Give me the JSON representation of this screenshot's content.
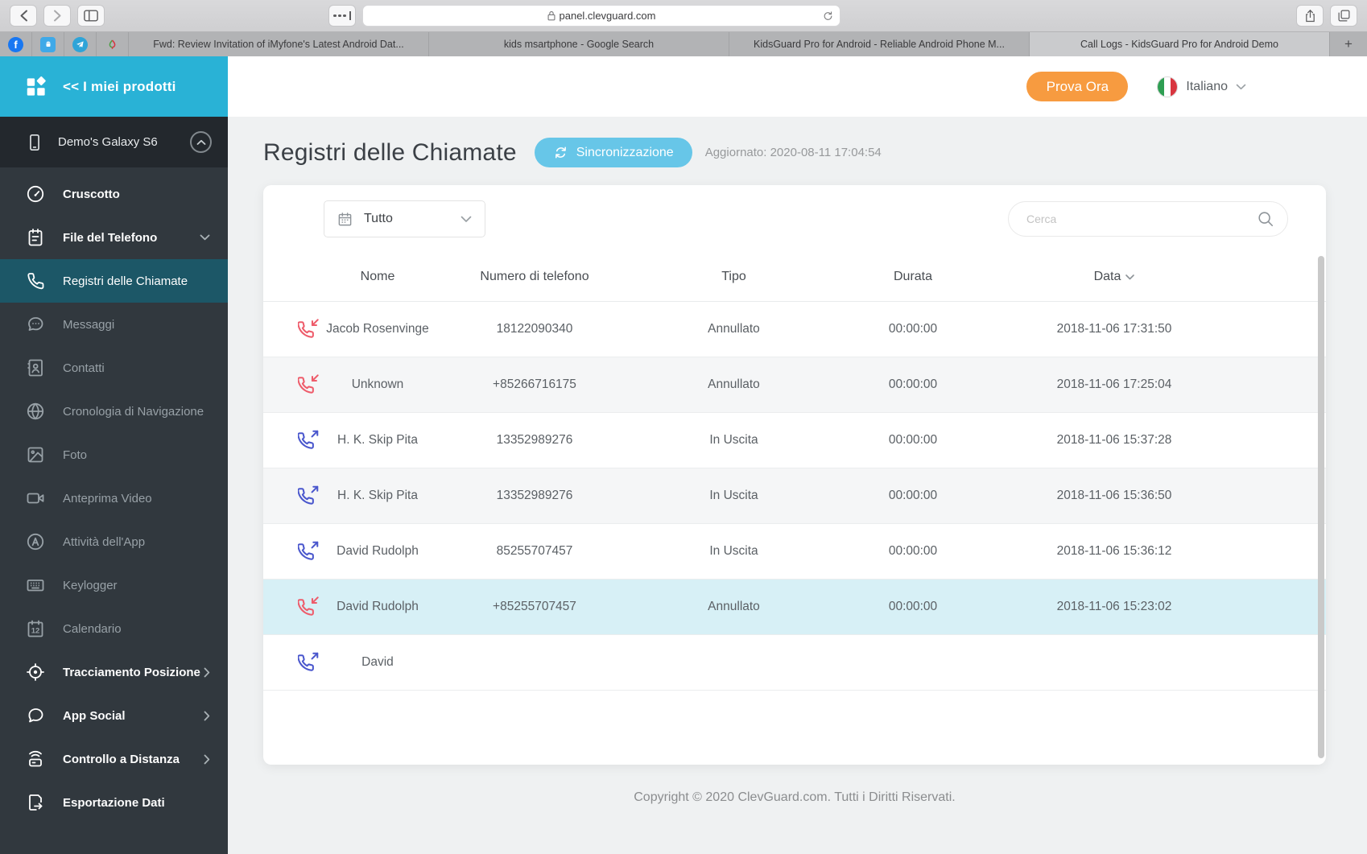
{
  "browser": {
    "url": "panel.clevguard.com",
    "new_tab_label": "+",
    "pinned_tabs": [
      "facebook",
      "android",
      "telegram",
      "imyfone"
    ],
    "tabs": [
      {
        "label": "Fwd: Review Invitation of iMyfone's Latest Android Dat..."
      },
      {
        "label": "kids msartphone - Google Search"
      },
      {
        "label": "KidsGuard Pro for Android - Reliable Android Phone M..."
      },
      {
        "label": "Call Logs - KidsGuard Pro for Android Demo",
        "active": true
      }
    ]
  },
  "sidebar": {
    "products_label": "<< I miei prodotti",
    "device_name": "Demo's Galaxy S6",
    "items": [
      {
        "label": "Cruscotto",
        "icon": "dashboard-icon",
        "bold": true
      },
      {
        "label": "File del Telefono",
        "icon": "phone-files-icon",
        "bold": true
      },
      {
        "label": "Registri delle Chiamate",
        "icon": "call-logs-icon",
        "active": true
      },
      {
        "label": "Messaggi",
        "icon": "messages-icon"
      },
      {
        "label": "Contatti",
        "icon": "contacts-icon"
      },
      {
        "label": "Cronologia di Navigazione",
        "icon": "browsing-history-icon"
      },
      {
        "label": "Foto",
        "icon": "photos-icon"
      },
      {
        "label": "Anteprima Video",
        "icon": "video-preview-icon"
      },
      {
        "label": "Attività dell'App",
        "icon": "app-activity-icon"
      },
      {
        "label": "Keylogger",
        "icon": "keylogger-icon"
      },
      {
        "label": "Calendario",
        "icon": "calendar-icon"
      },
      {
        "label": "Tracciamento Posizione",
        "icon": "location-tracking-icon",
        "bold": true
      },
      {
        "label": "App Social",
        "icon": "social-apps-icon",
        "bold": true
      },
      {
        "label": "Controllo a Distanza",
        "icon": "remote-control-icon",
        "bold": true
      },
      {
        "label": "Esportazione Dati",
        "icon": "data-export-icon",
        "bold": true
      }
    ]
  },
  "topbar": {
    "trial_button": "Prova Ora",
    "language": "Italiano"
  },
  "page": {
    "title": "Registri delle Chiamate",
    "sync_button": "Sincronizzazione",
    "updated": "Aggiornato: 2020-08-11 17:04:54"
  },
  "filters": {
    "date_filter": "Tutto",
    "search_placeholder": "Cerca"
  },
  "table": {
    "columns": [
      "Nome",
      "Numero di telefono",
      "Tipo",
      "Durata",
      "Data"
    ],
    "rows": [
      {
        "direction": "incoming",
        "name": "Jacob Rosenvinge",
        "phone": "18122090340",
        "type": "Annullato",
        "duration": "00:00:00",
        "date": "2018-11-06 17:31:50"
      },
      {
        "direction": "incoming",
        "name": "Unknown",
        "phone": "+85266716175",
        "type": "Annullato",
        "duration": "00:00:00",
        "date": "2018-11-06 17:25:04"
      },
      {
        "direction": "outgoing",
        "name": "H. K. Skip Pita",
        "phone": "13352989276",
        "type": "In Uscita",
        "duration": "00:00:00",
        "date": "2018-11-06 15:37:28"
      },
      {
        "direction": "outgoing",
        "name": "H. K. Skip Pita",
        "phone": "13352989276",
        "type": "In Uscita",
        "duration": "00:00:00",
        "date": "2018-11-06 15:36:50"
      },
      {
        "direction": "outgoing",
        "name": "David Rudolph",
        "phone": "85255707457",
        "type": "In Uscita",
        "duration": "00:00:00",
        "date": "2018-11-06 15:36:12"
      },
      {
        "direction": "incoming",
        "name": "David Rudolph",
        "phone": "+85255707457",
        "type": "Annullato",
        "duration": "00:00:00",
        "date": "2018-11-06 15:23:02",
        "highlighted": true
      },
      {
        "direction": "outgoing",
        "name": "David",
        "phone": "",
        "type": "",
        "duration": "",
        "date": ""
      }
    ]
  },
  "footer": {
    "copyright": "Copyright © 2020 ClevGuard.com. Tutti i Diritti Riservati."
  }
}
